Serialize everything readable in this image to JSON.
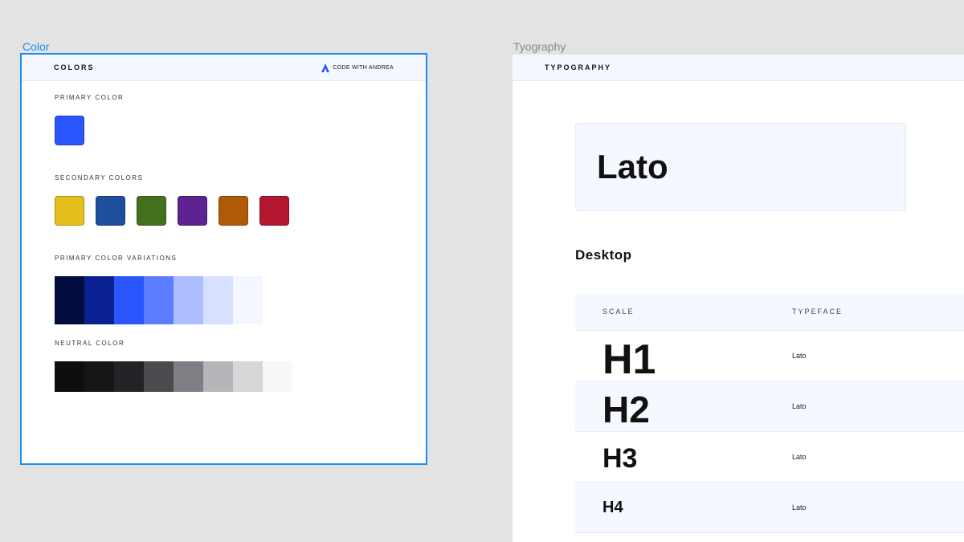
{
  "labels": {
    "color_frame": "Color",
    "typo_frame": "Tyography"
  },
  "colors_panel": {
    "title": "COLORS",
    "brand": "CODE WITH ANDREA",
    "primary_label": "PRIMARY COLOR",
    "primary_color": "#2b55ff",
    "secondary_label": "SECONDARY COLORS",
    "secondary_colors": [
      "#e5c01c",
      "#1e4f9d",
      "#44701e",
      "#5c2391",
      "#b05a07",
      "#b4152f"
    ],
    "variations_label": "PRIMARY COLOR VARIATIONS",
    "variations": [
      "#020c3d",
      "#0a2291",
      "#2b55ff",
      "#5b7dff",
      "#aebdff",
      "#d8e0ff",
      "#f4f7ff"
    ],
    "neutral_label": "NEUTRAL COLOR",
    "neutrals": [
      "#0e0e0e",
      "#161616",
      "#222326",
      "#4a4b4f",
      "#7e7f85",
      "#b5b6ba",
      "#d6d7d9",
      "#f6f7f8"
    ]
  },
  "typography_panel": {
    "title": "TYPOGRAPHY",
    "font_name": "Lato",
    "section": "Desktop",
    "col_scale": "SCALE",
    "col_typeface": "TYPEFACE",
    "rows": [
      {
        "scale": "H1",
        "typeface": "Lato"
      },
      {
        "scale": "H2",
        "typeface": "Lato"
      },
      {
        "scale": "H3",
        "typeface": "Lato"
      },
      {
        "scale": "H4",
        "typeface": "Lato"
      }
    ]
  }
}
